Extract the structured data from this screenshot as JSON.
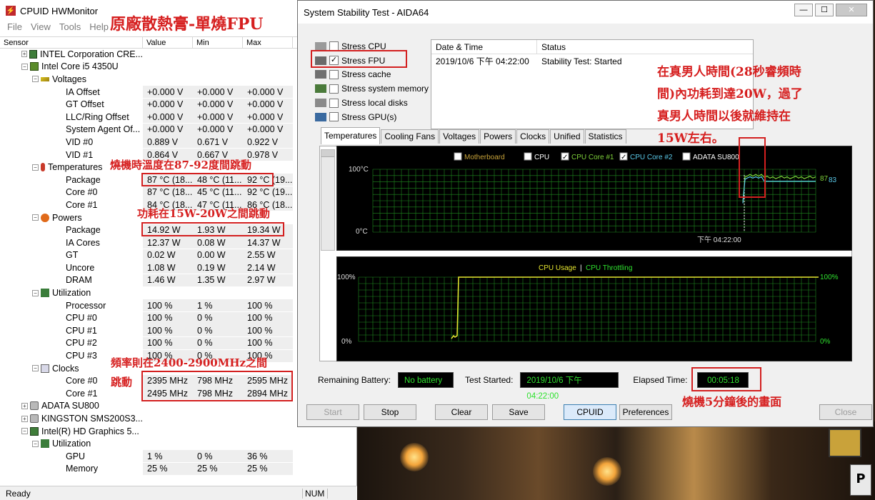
{
  "hwmonitor": {
    "title": "CPUID HWMonitor",
    "menu": [
      "File",
      "View",
      "Tools",
      "Help"
    ],
    "columns": [
      "Sensor",
      "Value",
      "Min",
      "Max"
    ],
    "rows": [
      {
        "indent": 1,
        "name": "INTEL Corporation CRE...",
        "icon": "motherboard-icon",
        "exp": "+"
      },
      {
        "indent": 1,
        "name": "Intel Core i5 4350U",
        "icon": "cpu-icon",
        "exp": "-"
      },
      {
        "indent": 2,
        "name": "Voltages",
        "icon": "voltage-icon",
        "exp": "-"
      },
      {
        "indent": 3,
        "name": "IA Offset",
        "v": "+0.000 V",
        "min": "+0.000 V",
        "max": "+0.000 V"
      },
      {
        "indent": 3,
        "name": "GT Offset",
        "v": "+0.000 V",
        "min": "+0.000 V",
        "max": "+0.000 V"
      },
      {
        "indent": 3,
        "name": "LLC/Ring Offset",
        "v": "+0.000 V",
        "min": "+0.000 V",
        "max": "+0.000 V"
      },
      {
        "indent": 3,
        "name": "System Agent Of...",
        "v": "+0.000 V",
        "min": "+0.000 V",
        "max": "+0.000 V"
      },
      {
        "indent": 3,
        "name": "VID #0",
        "v": "0.889 V",
        "min": "0.671 V",
        "max": "0.922 V"
      },
      {
        "indent": 3,
        "name": "VID #1",
        "v": "0.864 V",
        "min": "0.667 V",
        "max": "0.978 V"
      },
      {
        "indent": 2,
        "name": "Temperatures",
        "icon": "thermometer-icon",
        "exp": "-"
      },
      {
        "indent": 3,
        "name": "Package",
        "v": "87 °C  (18...",
        "min": "48 °C  (11...",
        "max": "92 °C  (19..."
      },
      {
        "indent": 3,
        "name": "Core #0",
        "v": "87 °C  (18...",
        "min": "45 °C  (11...",
        "max": "92 °C  (19..."
      },
      {
        "indent": 3,
        "name": "Core #1",
        "v": "84 °C  (18...",
        "min": "47 °C  (11...",
        "max": "86 °C  (18..."
      },
      {
        "indent": 2,
        "name": "Powers",
        "icon": "power-icon",
        "exp": "-"
      },
      {
        "indent": 3,
        "name": "Package",
        "v": "14.92 W",
        "min": "1.93 W",
        "max": "19.34 W"
      },
      {
        "indent": 3,
        "name": "IA Cores",
        "v": "12.37 W",
        "min": "0.08 W",
        "max": "14.37 W"
      },
      {
        "indent": 3,
        "name": "GT",
        "v": "0.02 W",
        "min": "0.00 W",
        "max": "2.55 W"
      },
      {
        "indent": 3,
        "name": "Uncore",
        "v": "1.08 W",
        "min": "0.19 W",
        "max": "2.14 W"
      },
      {
        "indent": 3,
        "name": "DRAM",
        "v": "1.46 W",
        "min": "1.35 W",
        "max": "2.97 W"
      },
      {
        "indent": 2,
        "name": "Utilization",
        "icon": "utilization-icon",
        "exp": "-"
      },
      {
        "indent": 3,
        "name": "Processor",
        "v": "100 %",
        "min": "1 %",
        "max": "100 %"
      },
      {
        "indent": 3,
        "name": "CPU #0",
        "v": "100 %",
        "min": "0 %",
        "max": "100 %"
      },
      {
        "indent": 3,
        "name": "CPU #1",
        "v": "100 %",
        "min": "0 %",
        "max": "100 %"
      },
      {
        "indent": 3,
        "name": "CPU #2",
        "v": "100 %",
        "min": "0 %",
        "max": "100 %"
      },
      {
        "indent": 3,
        "name": "CPU #3",
        "v": "100 %",
        "min": "0 %",
        "max": "100 %"
      },
      {
        "indent": 2,
        "name": "Clocks",
        "icon": "clock-icon",
        "exp": "-"
      },
      {
        "indent": 3,
        "name": "Core #0",
        "v": "2395 MHz",
        "min": "798 MHz",
        "max": "2595 MHz"
      },
      {
        "indent": 3,
        "name": "Core #1",
        "v": "2495 MHz",
        "min": "798 MHz",
        "max": "2894 MHz"
      },
      {
        "indent": 1,
        "name": "ADATA SU800",
        "icon": "disk-icon",
        "exp": "+"
      },
      {
        "indent": 1,
        "name": "KINGSTON SMS200S3...",
        "icon": "disk-icon",
        "exp": "+"
      },
      {
        "indent": 1,
        "name": "Intel(R) HD Graphics 5...",
        "icon": "gpu-icon",
        "exp": "-"
      },
      {
        "indent": 2,
        "name": "Utilization",
        "icon": "utilization-icon",
        "exp": "-"
      },
      {
        "indent": 3,
        "name": "GPU",
        "v": "1 %",
        "min": "0 %",
        "max": "36 %"
      },
      {
        "indent": 3,
        "name": "Memory",
        "v": "25 %",
        "min": "25 %",
        "max": "25 %"
      }
    ],
    "status": "Ready",
    "num_indicator": "NUM"
  },
  "annotations": {
    "title": "原廠散熱膏-單燒FPU",
    "temp": "燒機時溫度在87-92度間跳動",
    "power": "功耗在15W-20W之間跳動",
    "freq_line1": "頻率則在2400-2900MHz之間",
    "freq_line2": "跳動",
    "turbo_line1": "在真男人時間(28秒睿頻時",
    "turbo_line2": "間)內功耗到達20W，過了",
    "turbo_line3": "真男人時間以後就維持在",
    "turbo_line4": "15W左右。",
    "elapsed": "燒機5分鐘後的畫面"
  },
  "aida": {
    "title": "System Stability Test - AIDA64",
    "stress": [
      {
        "label": "Stress CPU",
        "checked": false
      },
      {
        "label": "Stress FPU",
        "checked": true
      },
      {
        "label": "Stress cache",
        "checked": false
      },
      {
        "label": "Stress system memory",
        "checked": false
      },
      {
        "label": "Stress local disks",
        "checked": false
      },
      {
        "label": "Stress GPU(s)",
        "checked": false
      }
    ],
    "status_table": {
      "headers": [
        "Date & Time",
        "Status"
      ],
      "row": [
        "2019/10/6 下午 04:22:00",
        "Stability Test: Started"
      ]
    },
    "tabs": [
      "Temperatures",
      "Cooling Fans",
      "Voltages",
      "Powers",
      "Clocks",
      "Unified",
      "Statistics"
    ],
    "temp_graph": {
      "legend": [
        {
          "label": "Motherboard",
          "checked": false,
          "color": "#c8a33a"
        },
        {
          "label": "CPU",
          "checked": false,
          "color": "#ffffff"
        },
        {
          "label": "CPU Core #1",
          "checked": true,
          "color": "#7ed03a"
        },
        {
          "label": "CPU Core #2",
          "checked": true,
          "color": "#5ac8e8"
        },
        {
          "label": "ADATA SU800",
          "checked": false,
          "color": "#ffffff"
        }
      ],
      "y_top": "100°C",
      "y_bottom": "0°C",
      "x_label": "下午 04:22:00",
      "end_value_1": "87",
      "end_value_2": "83"
    },
    "usage_graph": {
      "legend_usage": "CPU Usage",
      "legend_sep": "|",
      "legend_throttle": "CPU Throttling",
      "y_top_left": "100%",
      "y_bottom_left": "0%",
      "y_top_right": "100%",
      "y_bottom_right": "0%"
    },
    "remaining_battery_label": "Remaining Battery:",
    "remaining_battery_value": "No battery",
    "test_started_label": "Test Started:",
    "test_started_value": "2019/10/6 下午 04:22:00",
    "elapsed_label": "Elapsed Time:",
    "elapsed_value": "00:05:18",
    "buttons": {
      "start": "Start",
      "stop": "Stop",
      "clear": "Clear",
      "save": "Save",
      "cpuid": "CPUID",
      "preferences": "Preferences",
      "close": "Close"
    }
  }
}
